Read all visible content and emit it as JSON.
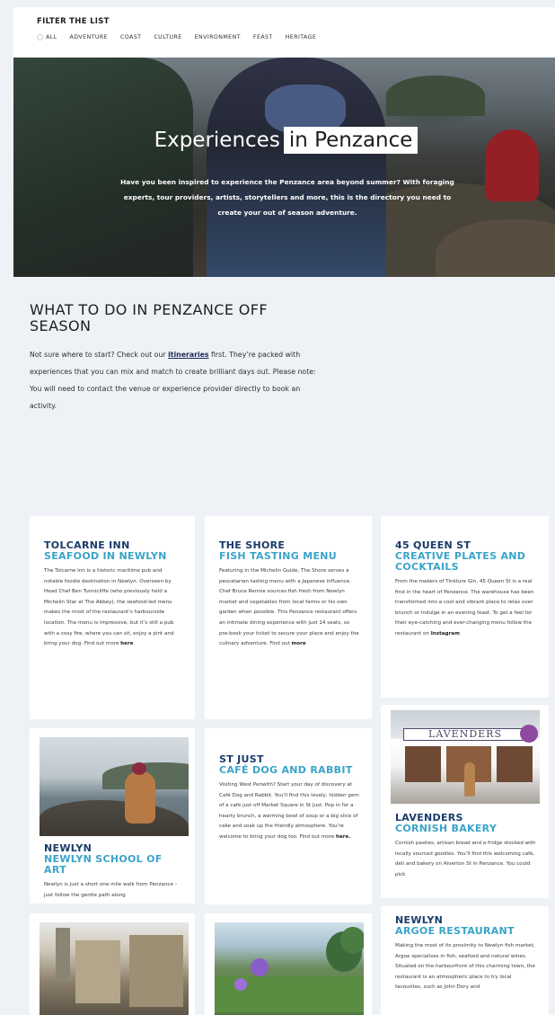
{
  "filter": {
    "title": "FILTER THE LIST",
    "items": [
      "ALL",
      "ADVENTURE",
      "COAST",
      "CULTURE",
      "ENVIRONMENT",
      "FEAST",
      "HERITAGE"
    ]
  },
  "hero": {
    "title_part1": "Experiences",
    "title_part2": "in Penzance",
    "subtitle": "Have you been inspired to experience the Penzance area beyond summer? With foraging experts, tour providers, artists, storytellers and more, this is the directory you need to create your out of season adventure."
  },
  "intro": {
    "title": "WHAT TO DO IN PENZANCE OFF SEASON",
    "text_before_link": "Not sure where to start? Check out our ",
    "link": "itineraries",
    "text_after_link": " first. They’re packed with experiences that you can mix and match to create brilliant days out. Please note: You will need to contact the venue or experience provider directly to book an activity."
  },
  "cards": {
    "tolcarne": {
      "title": "TOLCARNE INN",
      "subtitle": "SEAFOOD IN NEWLYN",
      "text": "The Tolcarne Inn is a historic maritime pub and notable foodie destination in Newlyn. Overseen by Head Chef Ben Tunnicliffe (who previously held a Michelin Star at The Abbey), the seafood-led menu makes the most of the restaurant’s harbourside location. The menu is impressive, but it’s still a pub with a cosy fire, where you can sit, enjoy a pint and bring your dog. Find out more",
      "link": "here"
    },
    "shore": {
      "title": "THE SHORE",
      "subtitle": "FISH TASTING MENU",
      "text": "Featuring in the Michelin Guide, The Shore serves a pescatarian tasting menu with a Japanese influence. Chef Bruce Rennie sources fish fresh from Newlyn market and vegetables from local farms or his own garden when possible. This Penzance restaurant offers an intimate dining experience with just 14 seats, so pre-book your ticket to secure your place and enjoy the culinary adventure. Find out",
      "link": "more"
    },
    "queen": {
      "title": "45 QUEEN ST",
      "subtitle": "CREATIVE PLATES AND COCKTAILS",
      "text": "From the makers of Tinkture Gin, 45 Queen St is a real find in the heart of Penzance. The warehouse has been transformed into a cool and vibrant place to relax over brunch or indulge in an evening feast. To get a feel for their eye-catching and ever-changing menu follow the restaurant on",
      "link": "Instagram"
    },
    "newlyn_art": {
      "title": "NEWLYN",
      "subtitle": "NEWLYN SCHOOL OF ART",
      "text": "Newlyn is just a short one mile walk from Penzance – just follow the gentle path along"
    },
    "stjust": {
      "title": "ST JUST",
      "subtitle": "CAFÉ DOG AND RABBIT",
      "text": "Visiting West Penwith? Start your day of discovery at Café Dog and Rabbit. You’ll find this lovely, hidden gem of a café just off Market Square in St Just. Pop in for a hearty brunch, a warming bowl of soup or a big slice of cake and soak up the friendly atmosphere. You’re welcome to bring your dog too. Find out more",
      "link": "here."
    },
    "lavenders": {
      "title": "LAVENDERS",
      "subtitle": "CORNISH BAKERY",
      "text": "Cornish pasties, artisan bread and a fridge stocked with locally sourced goodies. You’ll find this welcoming café, deli and bakery on Alverton St in Penzance. You could pick",
      "sign": "LAVENDERS"
    },
    "argoe": {
      "title": "NEWLYN",
      "subtitle": "ARGOE RESTAURANT",
      "text": "Making the most of its proximity to Newlyn fish market, Argoe specialises in fish, seafood and natural wines. Situated on the harbourfront of this charming town, the restaurant is an atmospheric place to try local favourites, such as John Dory and"
    }
  },
  "colors": {
    "navy": "#1a3b6a",
    "cyan": "#3aa3c9",
    "background": "#eef1f5"
  }
}
